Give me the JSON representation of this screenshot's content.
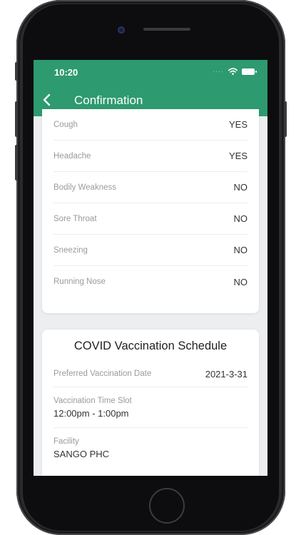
{
  "status_bar": {
    "time": "10:20",
    "signal_dots": "····"
  },
  "header": {
    "title": "Confirmation"
  },
  "symptoms": [
    {
      "label": "Cough",
      "value": "YES"
    },
    {
      "label": "Headache",
      "value": "YES"
    },
    {
      "label": "Bodily Weakness",
      "value": "NO"
    },
    {
      "label": "Sore Throat",
      "value": "NO"
    },
    {
      "label": "Sneezing",
      "value": "NO"
    },
    {
      "label": "Running Nose",
      "value": "NO"
    }
  ],
  "schedule": {
    "title": "COVID Vaccination Schedule",
    "preferred_date": {
      "label": "Preferred Vaccination Date",
      "value": "2021-3-31"
    },
    "time_slot": {
      "label": "Vaccination Time Slot",
      "value": "12:00pm - 1:00pm"
    },
    "facility": {
      "label": "Facility",
      "value": "SANGO PHC"
    }
  },
  "colors": {
    "header": "#2e9a6f",
    "background": "#eceef0"
  }
}
